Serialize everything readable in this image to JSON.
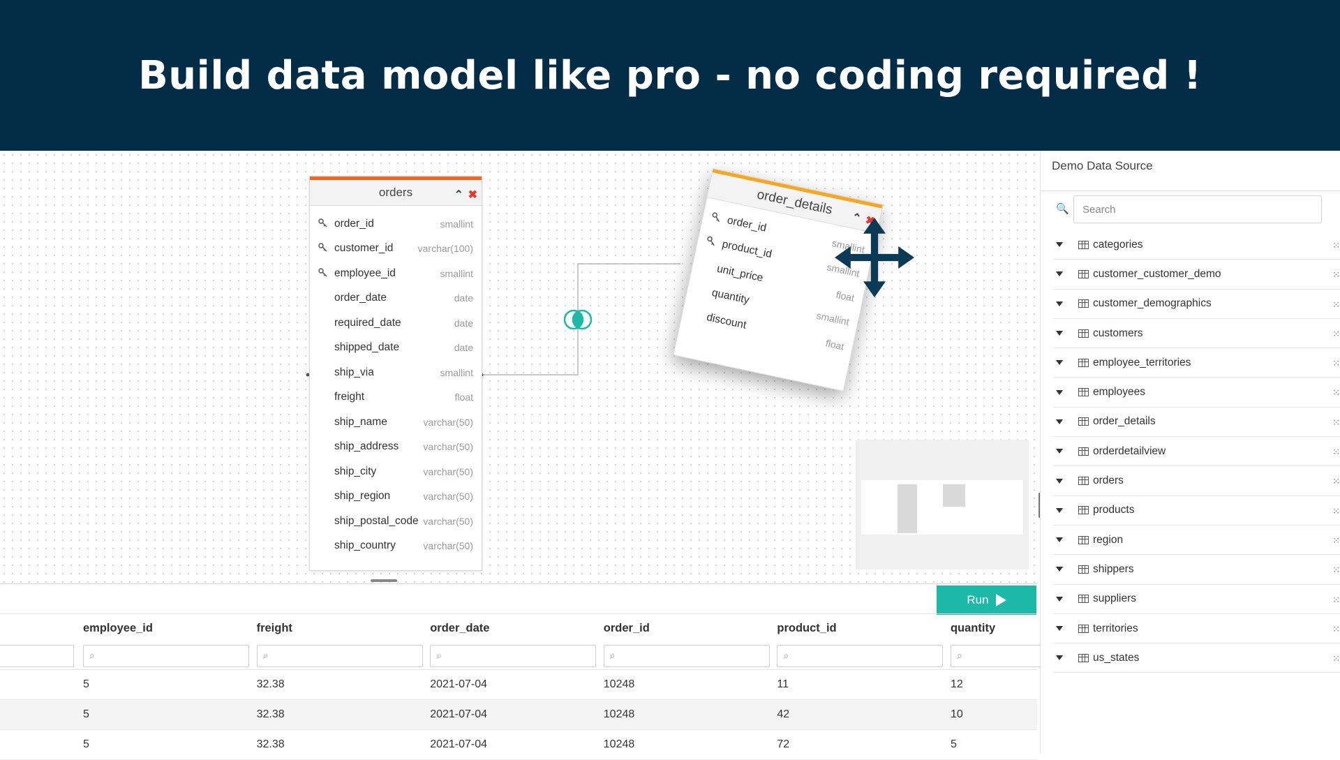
{
  "banner": {
    "title": "Build data model like pro - no coding required !"
  },
  "orders_table": {
    "title": "orders",
    "fields": [
      {
        "name": "order_id",
        "type": "smallint",
        "key": true
      },
      {
        "name": "customer_id",
        "type": "varchar(100)",
        "key": true
      },
      {
        "name": "employee_id",
        "type": "smallint",
        "key": true
      },
      {
        "name": "order_date",
        "type": "date",
        "key": false
      },
      {
        "name": "required_date",
        "type": "date",
        "key": false
      },
      {
        "name": "shipped_date",
        "type": "date",
        "key": false
      },
      {
        "name": "ship_via",
        "type": "smallint",
        "key": false
      },
      {
        "name": "freight",
        "type": "float",
        "key": false
      },
      {
        "name": "ship_name",
        "type": "varchar(50)",
        "key": false
      },
      {
        "name": "ship_address",
        "type": "varchar(50)",
        "key": false
      },
      {
        "name": "ship_city",
        "type": "varchar(50)",
        "key": false
      },
      {
        "name": "ship_region",
        "type": "varchar(50)",
        "key": false
      },
      {
        "name": "ship_postal_code",
        "type": "varchar(50)",
        "key": false
      },
      {
        "name": "ship_country",
        "type": "varchar(50)",
        "key": false
      }
    ]
  },
  "order_details_table": {
    "title": "order_details",
    "fields": [
      {
        "name": "order_id",
        "type": "smallint",
        "key": true
      },
      {
        "name": "product_id",
        "type": "smallint",
        "key": true
      },
      {
        "name": "unit_price",
        "type": "float",
        "key": false
      },
      {
        "name": "quantity",
        "type": "smallint",
        "key": false
      },
      {
        "name": "discount",
        "type": "float",
        "key": false
      }
    ]
  },
  "results": {
    "run_label": "Run",
    "columns": [
      "employee_id",
      "freight",
      "order_date",
      "order_id",
      "product_id",
      "quantity"
    ],
    "rows": [
      [
        "5",
        "32.38",
        "2021-07-04",
        "10248",
        "11",
        "12"
      ],
      [
        "5",
        "32.38",
        "2021-07-04",
        "10248",
        "42",
        "10"
      ],
      [
        "5",
        "32.38",
        "2021-07-04",
        "10248",
        "72",
        "5"
      ]
    ]
  },
  "sidebar": {
    "title": "Demo Data Source",
    "search_placeholder": "Search",
    "tables": [
      "categories",
      "customer_customer_demo",
      "customer_demographics",
      "customers",
      "employee_territories",
      "employees",
      "order_details",
      "orderdetailview",
      "orders",
      "products",
      "region",
      "shippers",
      "suppliers",
      "territories",
      "us_states"
    ]
  },
  "icons": {
    "key": "key-icon",
    "search": "search-icon",
    "table": "table-icon",
    "move": "move-icon",
    "close": "close-icon",
    "collapse": "chevron-up-icon",
    "run": "play-icon",
    "join": "inner-join-icon"
  },
  "colors": {
    "banner_bg": "#032d47",
    "orders_accent": "#f26522",
    "order_details_accent": "#f5a623",
    "run_button": "#1cb8a8",
    "close": "#e03a2f",
    "join": "#1cb8a8"
  }
}
